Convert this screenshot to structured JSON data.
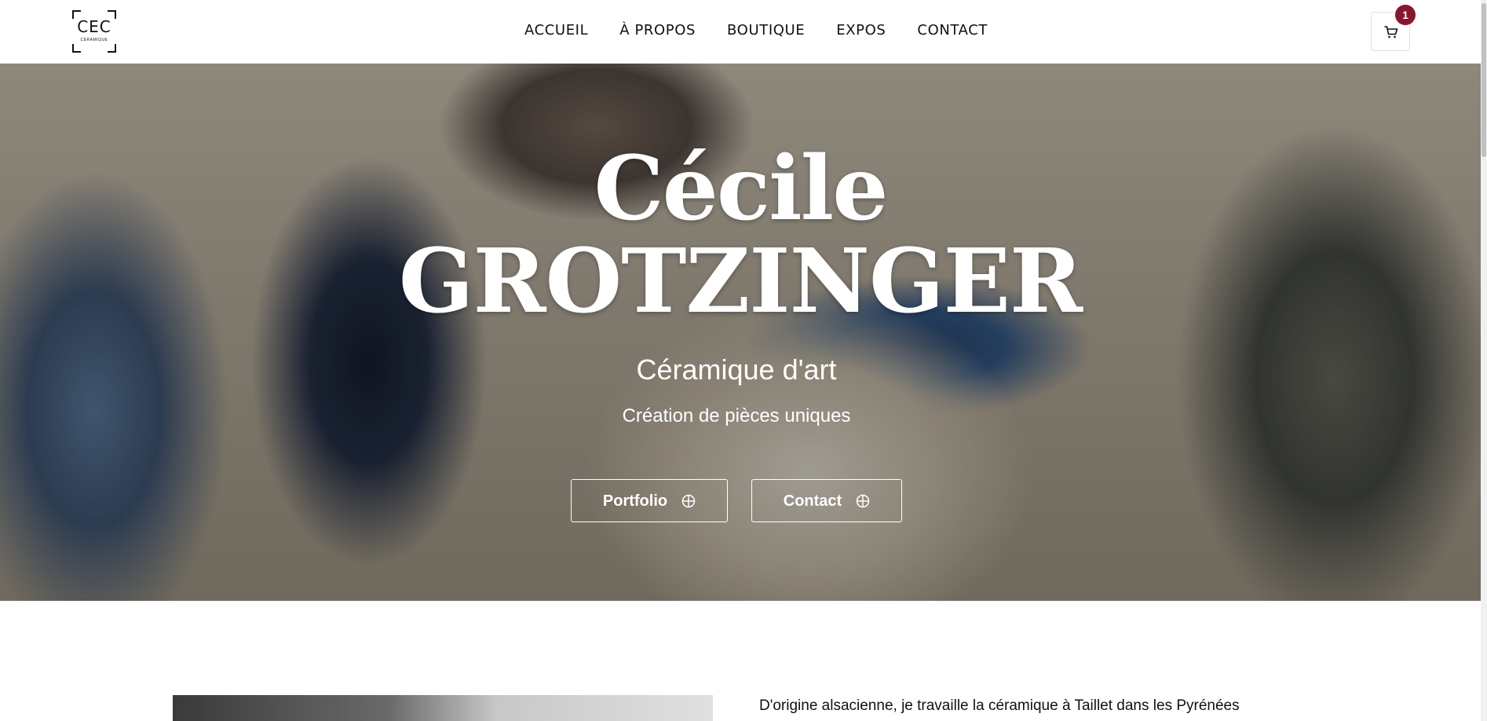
{
  "header": {
    "logo_mark": "CEC",
    "logo_sub": "CÉRAMIQUE",
    "nav": [
      "ACCUEIL",
      "À PROPOS",
      "BOUTIQUE",
      "EXPOS",
      "CONTACT"
    ],
    "cart_icon": "cart-icon",
    "cart_count": "1"
  },
  "hero": {
    "first_name": "Cécile",
    "last_name": "GROTZINGER",
    "subtitle": "Céramique d'art",
    "tagline": "Création de pièces uniques",
    "buttons": [
      {
        "label": "Portfolio",
        "icon": "plus-circle-icon"
      },
      {
        "label": "Contact",
        "icon": "plus-circle-icon"
      }
    ]
  },
  "about": {
    "intro": "D'origine alsacienne, je travaille la céramique à Taillet dans les Pyrénées"
  },
  "colors": {
    "badge": "#8b1530",
    "text": "#111111"
  }
}
